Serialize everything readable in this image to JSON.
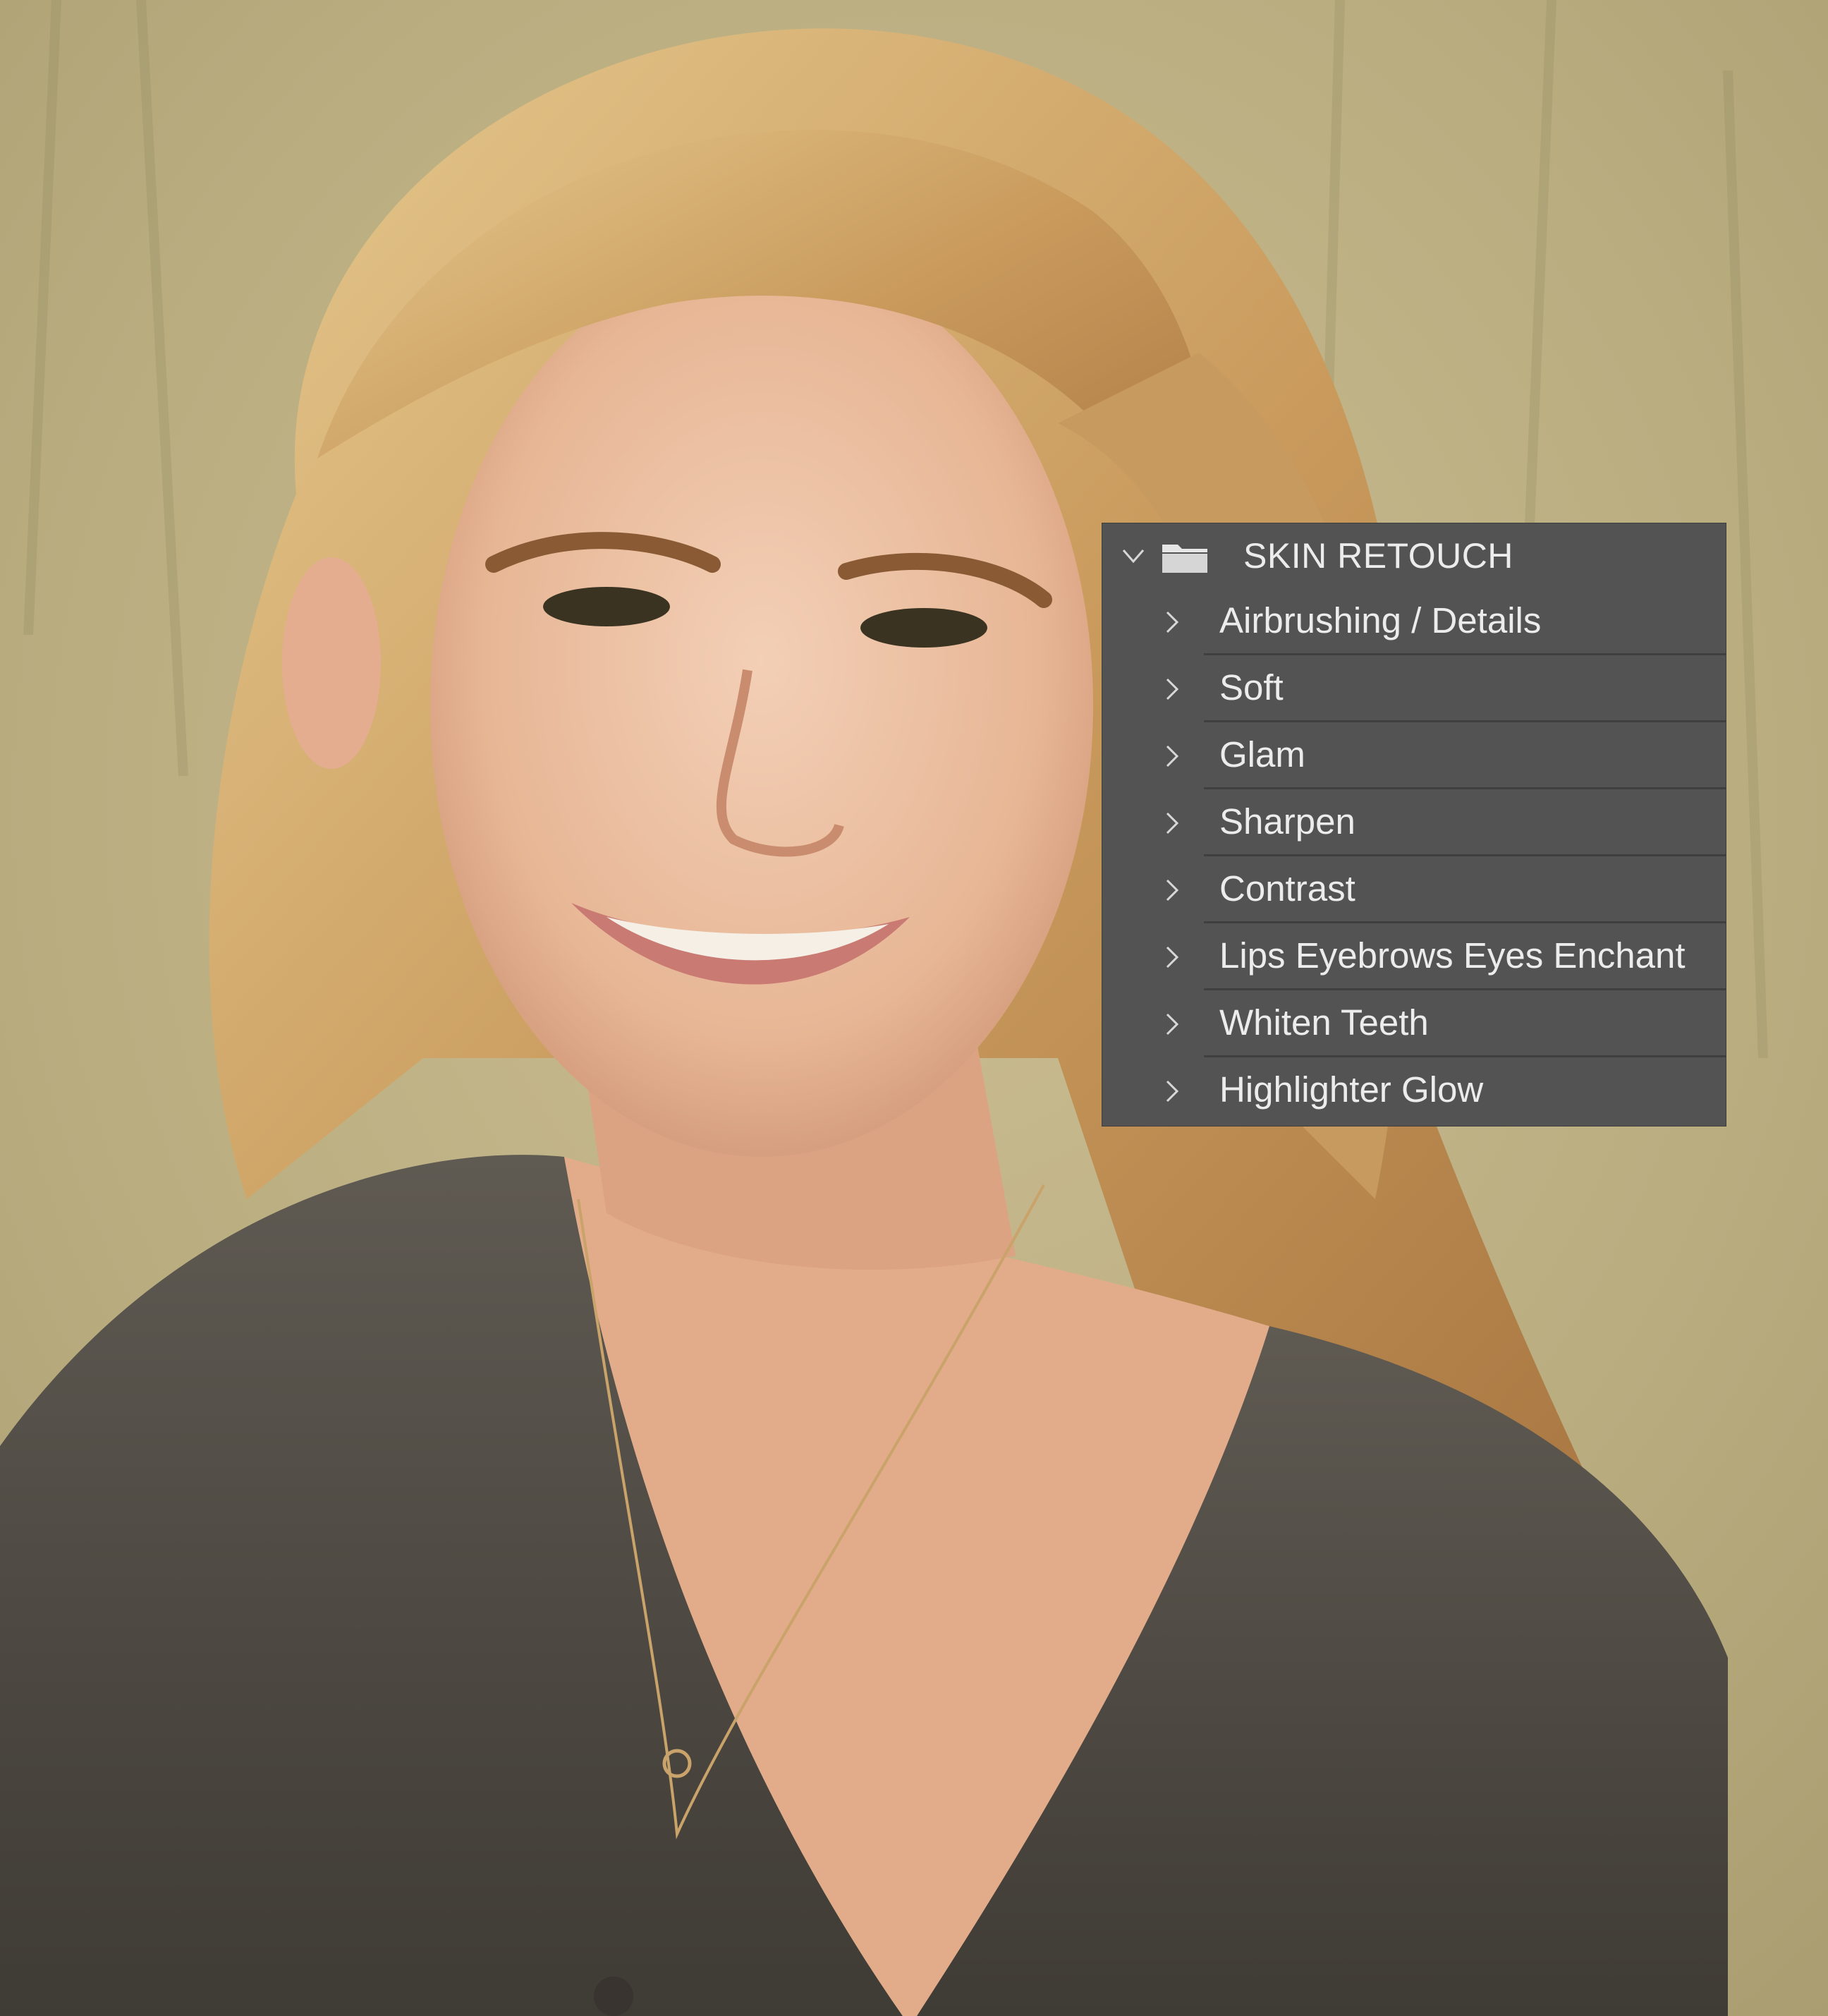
{
  "layers_panel": {
    "group": {
      "name": "SKIN RETOUCH",
      "expanded": true,
      "icon": "folder-icon"
    },
    "layers": [
      {
        "name": "Airbrushing / Details",
        "expanded": false
      },
      {
        "name": "Soft",
        "expanded": false
      },
      {
        "name": "Glam",
        "expanded": false
      },
      {
        "name": "Sharpen",
        "expanded": false
      },
      {
        "name": "Contrast",
        "expanded": false
      },
      {
        "name": "Lips Eyebrows Eyes Enchant",
        "expanded": false
      },
      {
        "name": "Whiten Teeth",
        "expanded": false
      },
      {
        "name": "Highlighter Glow",
        "expanded": false
      }
    ],
    "colors": {
      "panel_bg": "#535353",
      "divider": "#3f3f3f",
      "text": "#ececec"
    }
  }
}
